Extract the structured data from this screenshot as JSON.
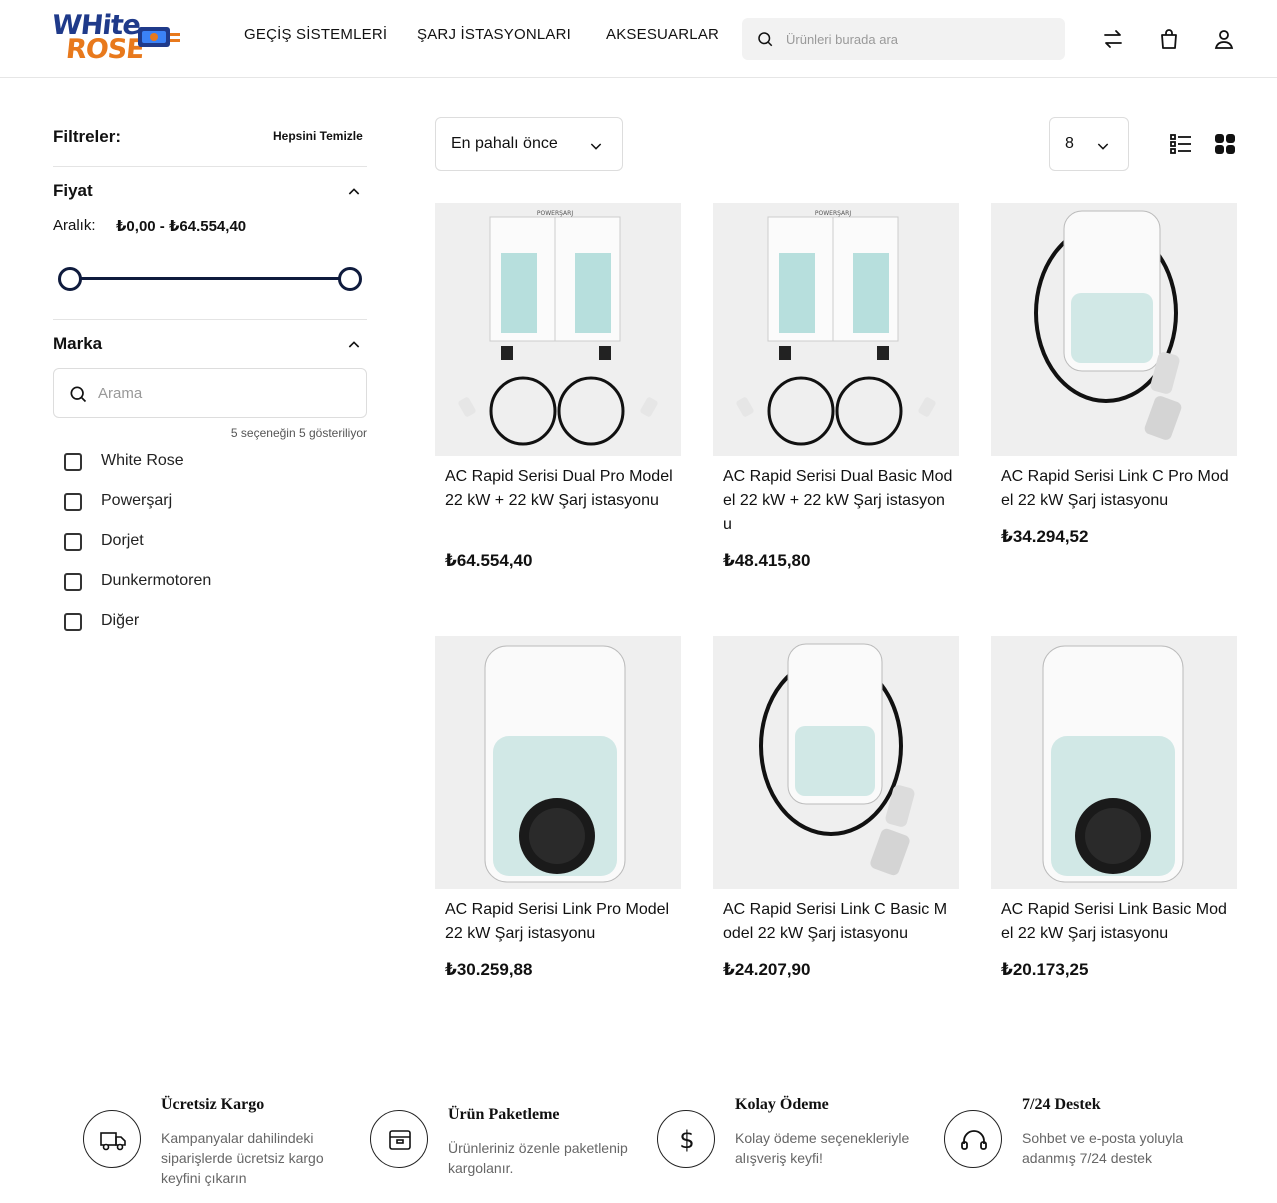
{
  "header": {
    "logo": {
      "line1": "WHite",
      "line2": "ROSE"
    },
    "nav": [
      "GEÇİŞ SİSTEMLERİ",
      "ŞARJ İSTASYONLARI",
      "AKSESUARLAR"
    ],
    "search_placeholder": "Ürünleri burada ara",
    "icons": [
      "compare-arrows-icon",
      "shopping-bag-icon",
      "user-icon"
    ]
  },
  "sidebar": {
    "title": "Filtreler:",
    "clear_all": "Hepsini Temizle",
    "price": {
      "title": "Fiyat",
      "range_label": "Aralık:",
      "range_value": "₺0,00 - ₺64.554,40",
      "min_fraction": 0,
      "max_fraction": 1
    },
    "brand": {
      "title": "Marka",
      "search_placeholder": "Arama",
      "showing": "5 seçeneğin 5 gösteriliyor",
      "options": [
        "White Rose",
        "Powerşarj",
        "Dorjet",
        "Dunkermotoren",
        "Diğer"
      ]
    }
  },
  "toolbar": {
    "sort_label": "En pahalı önce",
    "per_page": "8",
    "views": [
      "list-view-icon",
      "grid-view-icon"
    ]
  },
  "products": [
    {
      "name": "AC Rapid Serisi Dual Pro Model 22 kW + 22 kW Şarj istasyonu",
      "price": "₺64.554,40",
      "image": "dual-charger"
    },
    {
      "name": "AC Rapid Serisi Dual Basic Model 22 kW + 22 kW Şarj istasyonu",
      "price": "₺48.415,80",
      "image": "dual-charger"
    },
    {
      "name": "AC Rapid Serisi Link C Pro Model 22 kW Şarj istasyonu",
      "price": "₺34.294,52",
      "image": "cable-charger"
    },
    {
      "name": "AC Rapid Serisi Link Pro Model 22 kW Şarj istasyonu",
      "price": "₺30.259,88",
      "image": "socket-charger"
    },
    {
      "name": "AC Rapid Serisi Link C Basic Model 22 kW Şarj istasyonu",
      "price": "₺24.207,90",
      "image": "cable-charger"
    },
    {
      "name": "AC Rapid Serisi Link Basic Model 22 kW Şarj istasyonu",
      "price": "₺20.173,25",
      "image": "socket-charger"
    }
  ],
  "features": [
    {
      "title": "Ücretsiz Kargo",
      "desc": "Kampanyalar dahilindeki siparişlerde ücretsiz kargo keyfini çıkarın",
      "icon": "truck-icon"
    },
    {
      "title": "Ürün Paketleme",
      "desc": "Ürünleriniz özenle paketlenip kargolanır.",
      "icon": "package-icon"
    },
    {
      "title": "Kolay Ödeme",
      "desc": "Kolay ödeme seçenekleriyle alışveriş keyfi!",
      "icon": "dollar-icon"
    },
    {
      "title": "7/24 Destek",
      "desc": "Sohbet ve e-posta yoluyla adanmış 7/24 destek",
      "icon": "headset-icon"
    }
  ]
}
